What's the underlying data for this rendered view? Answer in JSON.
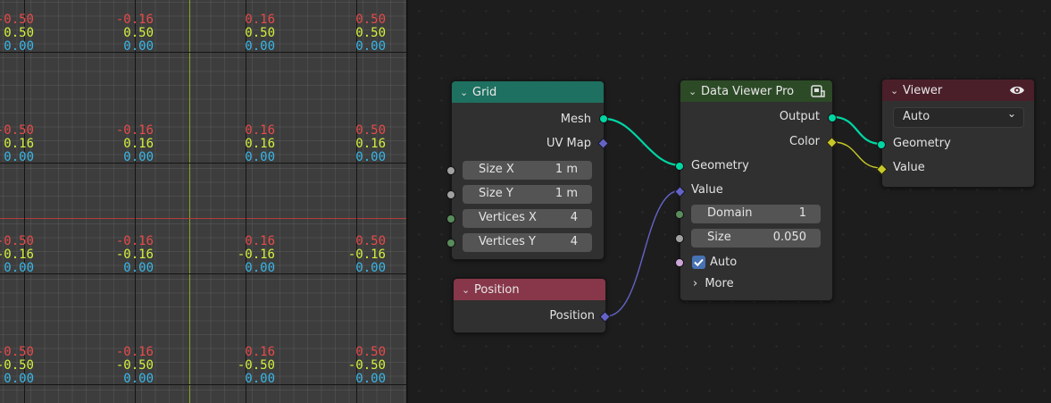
{
  "viewport": {
    "cells": [
      {
        "r": "-0.50",
        "y": "0.50",
        "b": "0.00"
      },
      {
        "r": "-0.16",
        "y": "0.50",
        "b": "0.00"
      },
      {
        "r": "0.16",
        "y": "0.50",
        "b": "0.00"
      },
      {
        "r": "0.50",
        "y": "0.50",
        "b": "0.00"
      },
      {
        "r": "-0.50",
        "y": "0.16",
        "b": "0.00"
      },
      {
        "r": "-0.16",
        "y": "0.16",
        "b": "0.00"
      },
      {
        "r": "0.16",
        "y": "0.16",
        "b": "0.00"
      },
      {
        "r": "0.50",
        "y": "0.16",
        "b": "0.00"
      },
      {
        "r": "-0.50",
        "y": "-0.16",
        "b": "0.00"
      },
      {
        "r": "-0.16",
        "y": "-0.16",
        "b": "0.00"
      },
      {
        "r": "0.16",
        "y": "-0.16",
        "b": "0.00"
      },
      {
        "r": "0.50",
        "y": "-0.16",
        "b": "0.00"
      },
      {
        "r": "-0.50",
        "y": "-0.50",
        "b": "0.00"
      },
      {
        "r": "-0.16",
        "y": "-0.50",
        "b": "0.00"
      },
      {
        "r": "0.16",
        "y": "-0.50",
        "b": "0.00"
      },
      {
        "r": "0.50",
        "y": "-0.50",
        "b": "0.00"
      }
    ],
    "colors": {
      "x_axis": "#b03a3a",
      "y_axis": "#7ea21a",
      "x_value": "#e84a4a",
      "y_value": "#d2f23c",
      "z_value": "#38b7e8"
    }
  },
  "nodes": {
    "grid": {
      "title": "Grid",
      "header_color": "#1e7060",
      "outputs": [
        "Mesh",
        "UV Map"
      ],
      "fields": [
        {
          "label": "Size X",
          "value": "1 m"
        },
        {
          "label": "Size Y",
          "value": "1 m"
        },
        {
          "label": "Vertices X",
          "value": "4"
        },
        {
          "label": "Vertices Y",
          "value": "4"
        }
      ]
    },
    "position": {
      "title": "Position",
      "header_color": "#873749",
      "output": "Position"
    },
    "data_viewer": {
      "title": "Data Viewer Pro",
      "header_color": "#2c4a26",
      "icon": "node-group-icon",
      "outputs": [
        "Output",
        "Color"
      ],
      "inputs": [
        "Geometry",
        "Value"
      ],
      "fields": [
        {
          "label": "Domain",
          "value": "1"
        },
        {
          "label": "Size",
          "value": "0.050"
        }
      ],
      "checkbox": {
        "label": "Auto",
        "checked": true
      },
      "more": "More"
    },
    "viewer": {
      "title": "Viewer",
      "header_color": "#4a1f29",
      "icon": "eye-icon",
      "dropdown": "Auto",
      "inputs": [
        "Geometry",
        "Value"
      ]
    }
  },
  "socket_colors": {
    "geometry": "#00d6a3",
    "vector": "#6363c7",
    "float": "#a1a1a1",
    "integer": "#598c5c",
    "color": "#c7c729",
    "boolean": "#cca6d6"
  }
}
